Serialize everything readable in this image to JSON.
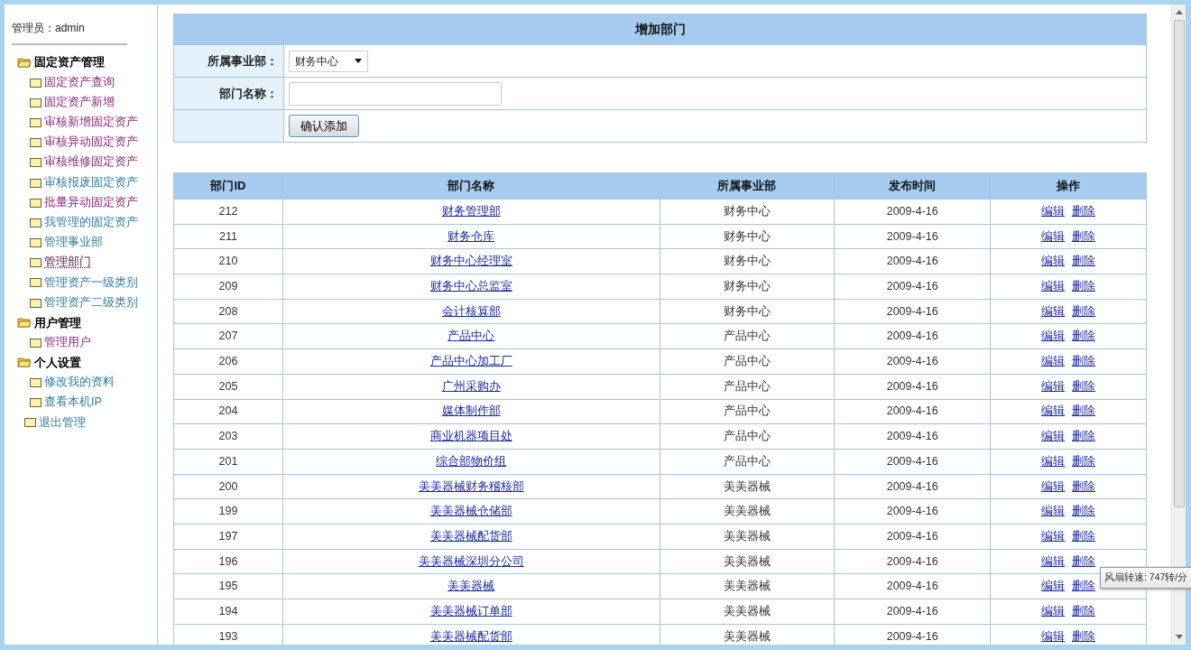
{
  "sidebar": {
    "admin_label": "管理员：admin",
    "tree": [
      {
        "label": "固定资产管理",
        "children": [
          {
            "label": "固定资产查询",
            "visited": true,
            "selected": false
          },
          {
            "label": "固定资产新增",
            "visited": true,
            "selected": false
          },
          {
            "label": "审核新增固定资产",
            "visited": true,
            "selected": false
          },
          {
            "label": "审核异动固定资产",
            "visited": true,
            "selected": false
          },
          {
            "label": "审核维修固定资产",
            "visited": true,
            "selected": false
          },
          {
            "label": "审核报废固定资产",
            "visited": false,
            "selected": false
          },
          {
            "label": "批量异动固定资产",
            "visited": true,
            "selected": false
          },
          {
            "label": "我管理的固定资产",
            "visited": false,
            "selected": false
          },
          {
            "label": "管理事业部",
            "visited": false,
            "selected": false
          },
          {
            "label": "管理部门",
            "visited": true,
            "selected": true
          },
          {
            "label": "管理资产一级类别",
            "visited": false,
            "selected": false
          },
          {
            "label": "管理资产二级类别",
            "visited": false,
            "selected": false
          }
        ]
      },
      {
        "label": "用户管理",
        "children": [
          {
            "label": "管理用户",
            "visited": true,
            "selected": false
          }
        ]
      },
      {
        "label": "个人设置",
        "children": [
          {
            "label": "修改我的资料",
            "visited": false,
            "selected": false
          },
          {
            "label": "查看本机IP",
            "visited": false,
            "selected": false
          }
        ]
      }
    ],
    "exit": {
      "label": "退出管理",
      "visited": false,
      "selected": false
    }
  },
  "form": {
    "title": "增加部门",
    "fields": [
      {
        "kind": "select",
        "label": "所属事业部：",
        "value": "财务中心"
      },
      {
        "kind": "text",
        "label": "部门名称："
      }
    ],
    "submit": "确认添加"
  },
  "table": {
    "columns": [
      "部门ID",
      "部门名称",
      "所属事业部",
      "发布时间",
      "操作"
    ],
    "rows": [
      {
        "id": "212",
        "name": "财务管理部",
        "unit": "财务中心",
        "date": "2009-4-16",
        "actions": [
          "编辑",
          "删除"
        ]
      },
      {
        "id": "211",
        "name": "财务仓库",
        "unit": "财务中心",
        "date": "2009-4-16",
        "actions": [
          "编辑",
          "删除"
        ]
      },
      {
        "id": "210",
        "name": "财务中心经理室",
        "unit": "财务中心",
        "date": "2009-4-16",
        "actions": [
          "编辑",
          "删除"
        ]
      },
      {
        "id": "209",
        "name": "财务中心总监室",
        "unit": "财务中心",
        "date": "2009-4-16",
        "actions": [
          "编辑",
          "删除"
        ]
      },
      {
        "id": "208",
        "name": "会计核算部",
        "unit": "财务中心",
        "date": "2009-4-16",
        "actions": [
          "编辑",
          "删除"
        ]
      },
      {
        "id": "207",
        "name": "产品中心",
        "unit": "产品中心",
        "date": "2009-4-16",
        "actions": [
          "编辑",
          "删除"
        ]
      },
      {
        "id": "206",
        "name": "产品中心加工厂",
        "unit": "产品中心",
        "date": "2009-4-16",
        "actions": [
          "编辑",
          "删除"
        ]
      },
      {
        "id": "205",
        "name": "广州采购办",
        "unit": "产品中心",
        "date": "2009-4-16",
        "actions": [
          "编辑",
          "删除"
        ]
      },
      {
        "id": "204",
        "name": "媒体制作部",
        "unit": "产品中心",
        "date": "2009-4-16",
        "actions": [
          "编辑",
          "删除"
        ]
      },
      {
        "id": "203",
        "name": "商业机器项目处",
        "unit": "产品中心",
        "date": "2009-4-16",
        "actions": [
          "编辑",
          "删除"
        ]
      },
      {
        "id": "201",
        "name": "综合部物价组",
        "unit": "产品中心",
        "date": "2009-4-16",
        "actions": [
          "编辑",
          "删除"
        ]
      },
      {
        "id": "200",
        "name": "美美器械财务稽核部",
        "unit": "美美器械",
        "date": "2009-4-16",
        "actions": [
          "编辑",
          "删除"
        ]
      },
      {
        "id": "199",
        "name": "美美器械仓储部",
        "unit": "美美器械",
        "date": "2009-4-16",
        "actions": [
          "编辑",
          "删除"
        ]
      },
      {
        "id": "197",
        "name": "美美器械配货部",
        "unit": "美美器械",
        "date": "2009-4-16",
        "actions": [
          "编辑",
          "删除"
        ]
      },
      {
        "id": "196",
        "name": "美美器械深圳分公司",
        "unit": "美美器械",
        "date": "2009-4-16",
        "actions": [
          "编辑",
          "删除"
        ]
      },
      {
        "id": "195",
        "name": "美美器械",
        "unit": "美美器械",
        "date": "2009-4-16",
        "actions": [
          "编辑",
          "删除"
        ]
      },
      {
        "id": "194",
        "name": "美美器械订单部",
        "unit": "美美器械",
        "date": "2009-4-16",
        "actions": [
          "编辑",
          "删除"
        ]
      },
      {
        "id": "193",
        "name": "美美器械配货部",
        "unit": "美美器械",
        "date": "2009-4-16",
        "actions": [
          "编辑",
          "删除"
        ]
      }
    ]
  },
  "tooltip": "风扇转速: 747转/分"
}
